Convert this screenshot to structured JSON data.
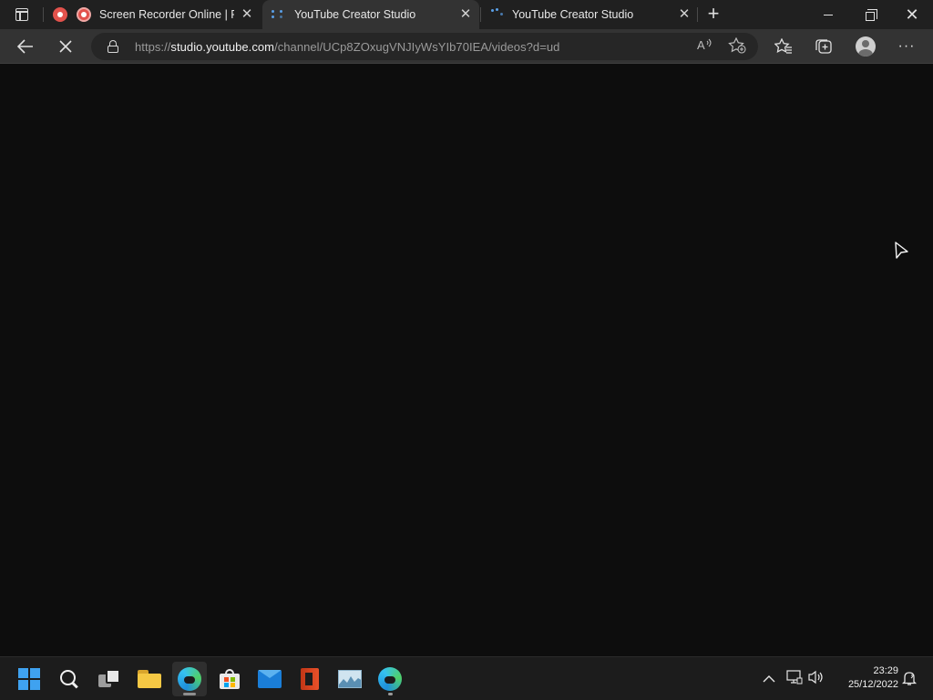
{
  "browser": {
    "tabs": [
      {
        "title": "Screen Recorder Online | Re",
        "icon": "record-icon",
        "active": false
      },
      {
        "title": "YouTube Creator Studio",
        "icon": "loading-spinner-icon",
        "active": true
      },
      {
        "title": "YouTube Creator Studio",
        "icon": "loading-spinner-icon",
        "active": false
      }
    ],
    "new_tab_label": "+",
    "address": {
      "scheme": "https://",
      "host": "studio.youtube.com",
      "path": "/channel/UCp8ZOxugVNJIyWsYIb70IEA/videos?d=ud"
    },
    "toolbar_icons": [
      "back-icon",
      "stop-loading-icon",
      "lock-icon",
      "read-aloud-icon",
      "add-favorite-icon",
      "favorites-icon",
      "collections-icon",
      "profile-icon",
      "more-icon"
    ]
  },
  "content": {
    "background": "#0d0d0d"
  },
  "taskbar": {
    "apps": [
      "start-icon",
      "search-icon",
      "task-view-icon",
      "file-explorer-icon",
      "edge-icon",
      "microsoft-store-icon",
      "mail-icon",
      "office-icon",
      "performance-monitor-icon",
      "edge-beta-icon"
    ],
    "tray": {
      "time": "23:29",
      "date": "25/12/2022"
    }
  },
  "colors": {
    "titlebar": "#202020",
    "toolbar": "#333333",
    "taskbar": "#1c1c1c",
    "accent": "#3fa2f0"
  }
}
